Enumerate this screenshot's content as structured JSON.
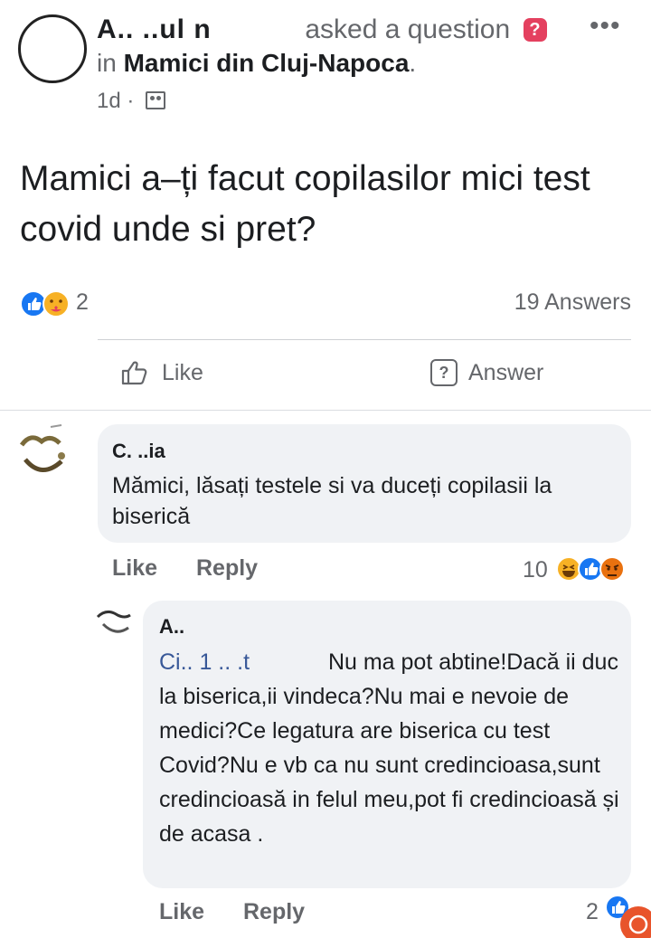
{
  "post": {
    "author_name": "A..  ..ul  n",
    "action_text": "asked a question",
    "question_badge": "?",
    "group_prefix": "in",
    "group_name": "Mamici din Cluj-Napoca",
    "group_suffix": ".",
    "time": "1d",
    "time_separator": "·",
    "more_label": "•••",
    "question_text": "Mamici a–ți facut copilasilor  mici test covid unde si pret?",
    "reaction_count": "2",
    "answers_count": "19 Answers",
    "like_label": "Like",
    "answer_label": "Answer",
    "answer_icon": "?"
  },
  "comments": [
    {
      "author_name": "C.  ..ia",
      "text": "Mămici, lăsați testele si va duceți copilasii la biserică",
      "like_label": "Like",
      "reply_label": "Reply",
      "reaction_count": "10",
      "replies": [
        {
          "author_name": "A..",
          "mention": "Ci..    1 ..   .t",
          "text": "Nu ma pot abtine!Dacă ii duc la biserica,ii vindeca?Nu mai e nevoie de medici?Ce legatura are biserica cu test Covid?Nu e vb ca nu sunt credincioasa,sunt credincioasă in felul meu,pot fi credincioasă și de acasa .",
          "like_label": "Like",
          "reply_label": "Reply",
          "reaction_count": "2"
        }
      ]
    }
  ],
  "icons": {
    "post_reactions": [
      "like-icon",
      "care-icon"
    ],
    "comment_reactions": [
      "haha-icon",
      "like-icon",
      "angry-icon"
    ],
    "reply_reactions": [
      "like-icon"
    ],
    "floating": "messenger-icon"
  },
  "colors": {
    "like_blue": "#1877f2",
    "care_yellow": "#f7b125",
    "angry_orange": "#e9710f",
    "question_badge": "#e4405f",
    "bubble_bg": "#f0f2f5",
    "meta_gray": "#65676b"
  }
}
